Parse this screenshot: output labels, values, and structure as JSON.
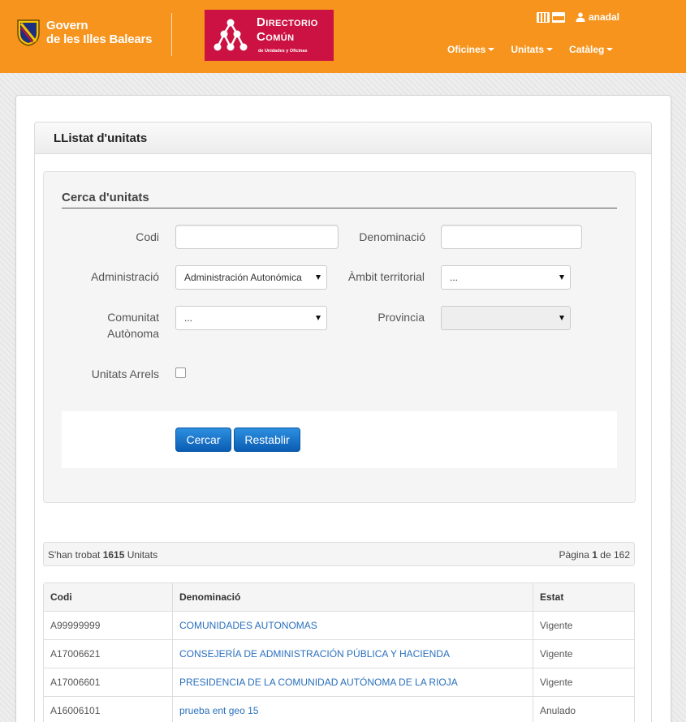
{
  "header": {
    "govern_line1": "Govern",
    "govern_line2": "de les Illes Balears",
    "dir_title1": "Directorio",
    "dir_title2": "Común",
    "dir_subtitle": "de Unidades y Oficinas",
    "user_name": "anadal",
    "lang_icons": [
      "catalan-flag-icon",
      "spanish-flag-icon"
    ],
    "nav": [
      {
        "label": "Oficines"
      },
      {
        "label": "Unitats"
      },
      {
        "label": "Catàleg"
      }
    ]
  },
  "panel": {
    "title": "LListat d'unitats"
  },
  "search": {
    "legend": "Cerca d'unitats",
    "codi_label": "Codi",
    "codi_value": "",
    "denominacio_label": "Denominació",
    "denominacio_value": "",
    "administracio_label": "Administració",
    "administracio_value": "Administración Autonómica",
    "ambit_label": "Àmbit territorial",
    "ambit_value": "...",
    "comunitat_label_1": "Comunitat",
    "comunitat_label_2": "Autònoma",
    "comunitat_value": "...",
    "provincia_label": "Provincia",
    "provincia_value": "",
    "arrels_label": "Unitats Arrels",
    "arrels_checked": false,
    "search_button": "Cercar",
    "reset_button": "Restablir"
  },
  "summary": {
    "found_prefix": "S'han trobat",
    "found_count": "1615",
    "found_suffix": "Unitats",
    "page_prefix": "Pàgina",
    "page_current": "1",
    "page_mid": "de",
    "page_total": "162"
  },
  "table": {
    "columns": [
      "Codi",
      "Denominació",
      "Estat"
    ],
    "rows": [
      {
        "codi": "A99999999",
        "denominacio": "COMUNIDADES AUTONOMAS",
        "estat": "Vigente"
      },
      {
        "codi": "A17006621",
        "denominacio": "CONSEJERÍA DE ADMINISTRACIÓN PÚBLICA Y HACIENDA",
        "estat": "Vigente"
      },
      {
        "codi": "A17006601",
        "denominacio": "PRESIDENCIA DE LA COMUNIDAD AUTÓNOMA DE LA RIOJA",
        "estat": "Vigente"
      },
      {
        "codi": "A16006101",
        "denominacio": "prueba ent geo 15",
        "estat": "Anulado"
      }
    ]
  },
  "colors": {
    "header_orange": "#f7941d",
    "logo_red": "#cc1242",
    "button_blue": "#0a5db3",
    "link_blue": "#2a6fbd"
  }
}
